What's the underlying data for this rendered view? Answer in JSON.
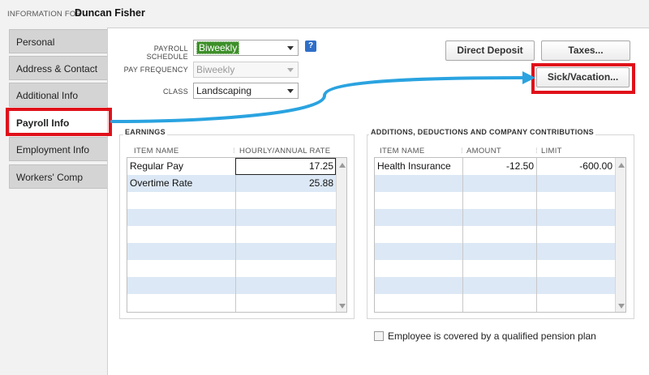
{
  "header": {
    "label": "INFORMATION FOR",
    "employee_name": "Duncan Fisher"
  },
  "sidebar": {
    "items": [
      {
        "label": "Personal",
        "active": false
      },
      {
        "label": "Address & Contact",
        "active": false
      },
      {
        "label": "Additional Info",
        "active": false
      },
      {
        "label": "Payroll Info",
        "active": true
      },
      {
        "label": "Employment Info",
        "active": false
      },
      {
        "label": "Workers' Comp",
        "active": false
      }
    ]
  },
  "form": {
    "payroll_schedule_label": "PAYROLL SCHEDULE",
    "payroll_schedule_value": "Biweekly",
    "help_label": "?",
    "pay_frequency_label": "PAY FREQUENCY",
    "pay_frequency_value": "Biweekly",
    "class_label": "CLASS",
    "class_value": "Landscaping"
  },
  "buttons": {
    "direct_deposit": "Direct Deposit",
    "taxes": "Taxes...",
    "sick_vacation": "Sick/Vacation..."
  },
  "earnings": {
    "title": "EARNINGS",
    "columns": [
      "ITEM NAME",
      "HOURLY/ANNUAL RATE"
    ],
    "rows": [
      {
        "item": "Regular Pay",
        "rate": "17.25"
      },
      {
        "item": "Overtime Rate",
        "rate": "25.88"
      }
    ]
  },
  "additions": {
    "title": "ADDITIONS, DEDUCTIONS AND COMPANY CONTRIBUTIONS",
    "columns": [
      "ITEM NAME",
      "AMOUNT",
      "LIMIT"
    ],
    "rows": [
      {
        "item": "Health Insurance",
        "amount": "-12.50",
        "limit": "-600.00"
      }
    ]
  },
  "pension_checkbox": {
    "label": "Employee is covered by a qualified pension plan",
    "checked": false
  },
  "colors": {
    "highlight_red": "#e0101a",
    "arrow_blue": "#2aa3e0",
    "selected_green": "#3d8f29",
    "row_alt_blue": "#dce8f5"
  }
}
